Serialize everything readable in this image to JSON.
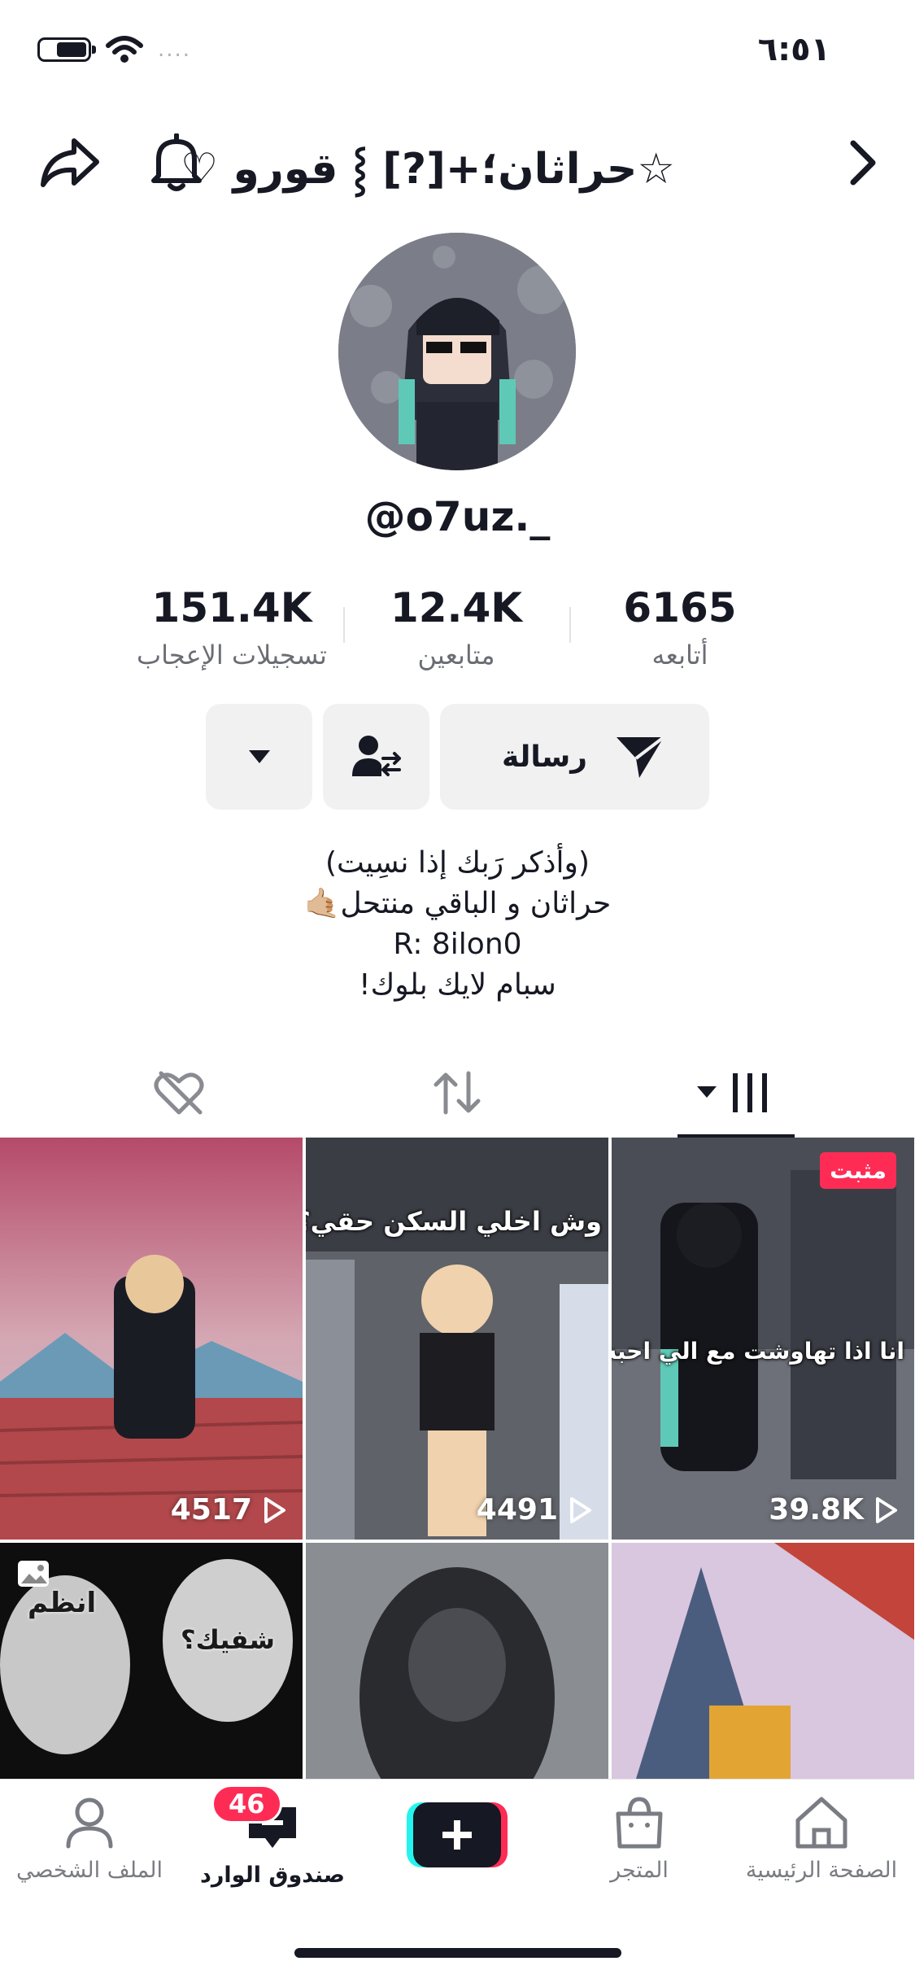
{
  "status_bar": {
    "time": "٦:٥١",
    "signal_placeholder": "...."
  },
  "header": {
    "title": "☆حراثان؛+[?] ⸾ قورو ♡",
    "back_icon": "chevron-right-icon",
    "bell_icon": "bell-icon",
    "share_icon": "share-arrow-icon"
  },
  "profile": {
    "username": "@o7uz._",
    "stats": [
      {
        "value": "151.4K",
        "label": "تسجيلات الإعجاب"
      },
      {
        "value": "12.4K",
        "label": "متابعين"
      },
      {
        "value": "6165",
        "label": "أتابعه"
      }
    ],
    "message_label": "رسالة",
    "bio": [
      "(وأذكر رَبك إذا نسِيت)",
      "حراثان و الباقي منتحل🤙🏼",
      "R: 8ilon0",
      "سبام لايك بلوك!"
    ]
  },
  "tabs": [
    "liked-hidden",
    "reposts",
    "videos"
  ],
  "grid": [
    {
      "views": "4517",
      "pinned": false
    },
    {
      "views": "4491",
      "pinned": false,
      "caption": "وش اخلي السكن حقي؟؟"
    },
    {
      "views": "39.8K",
      "pinned": true,
      "pinned_label": "مثبت",
      "caption": "انا اذا تهاوشت مع الي احبه:"
    },
    {
      "caption_a": "انظم",
      "caption_b": "شفيك؟"
    },
    {},
    {}
  ],
  "bottom_nav": {
    "items": [
      {
        "label": "الملف الشخصي",
        "icon": "person-icon"
      },
      {
        "label": "صندوق الوارد",
        "icon": "inbox-icon",
        "badge": "46"
      },
      {
        "label": "",
        "icon": "plus-icon"
      },
      {
        "label": "المتجر",
        "icon": "shopping-bag-icon"
      },
      {
        "label": "الصفحة الرئيسية",
        "icon": "home-icon"
      }
    ]
  },
  "colors": {
    "accent": "#fe2c55",
    "text": "#161823",
    "muted": "#6b6d75",
    "button_bg": "#f1f1f2"
  }
}
